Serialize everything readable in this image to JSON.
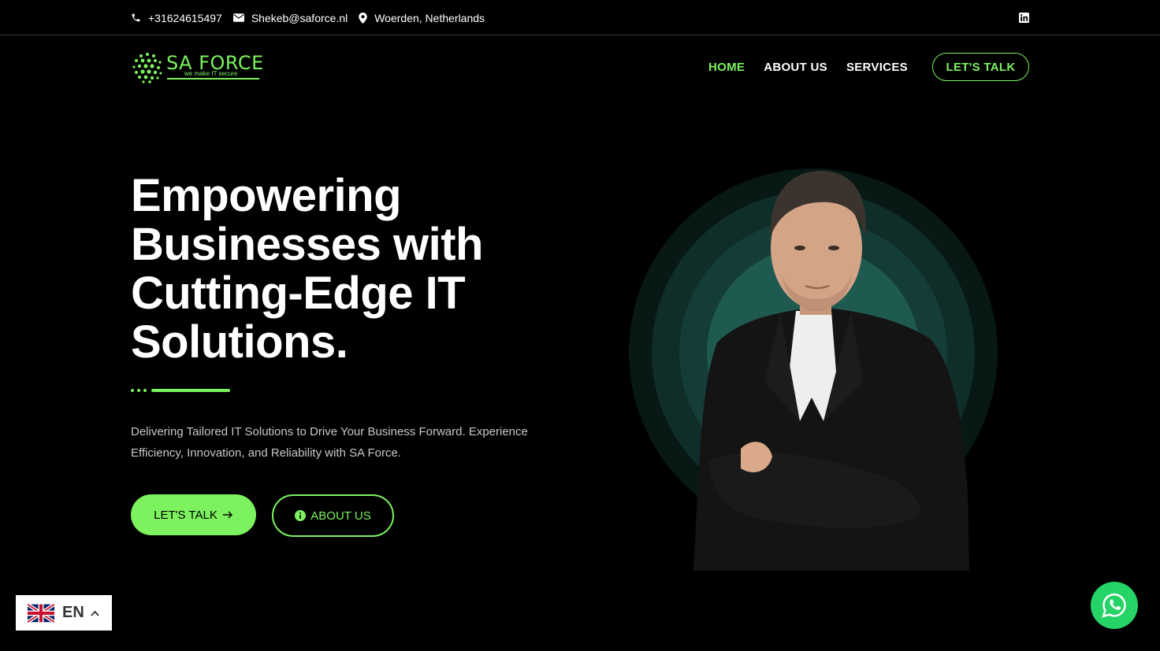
{
  "topbar": {
    "phone": "+31624615497",
    "email": "Shekeb@saforce.nl",
    "location": "Woerden, Netherlands",
    "social_icon": "linkedin-icon"
  },
  "header": {
    "logo_text": "SA FORCE",
    "logo_tagline": "we make IT secure",
    "nav": [
      {
        "label": "HOME",
        "active": true
      },
      {
        "label": "ABOUT US",
        "active": false
      },
      {
        "label": "SERVICES",
        "active": false
      }
    ],
    "cta_label": "LET'S TALK"
  },
  "hero": {
    "headline": "Empowering Businesses with Cutting-Edge IT Solutions.",
    "subtitle": "Delivering Tailored IT Solutions to Drive Your Business Forward. Experience Efficiency, Innovation, and Reliability with SA Force.",
    "primary_button": "LET'S TALK",
    "secondary_button": "ABOUT US"
  },
  "language": {
    "code": "EN",
    "flag_icon": "uk-flag-icon"
  },
  "chat": {
    "icon": "whatsapp-icon"
  },
  "colors": {
    "accent": "#7cf25e",
    "background": "#000000",
    "ring_outer": "#071815",
    "ring_mid": "#0f2e29",
    "ring_inner": "#1e5a50",
    "whatsapp": "#25d366"
  }
}
